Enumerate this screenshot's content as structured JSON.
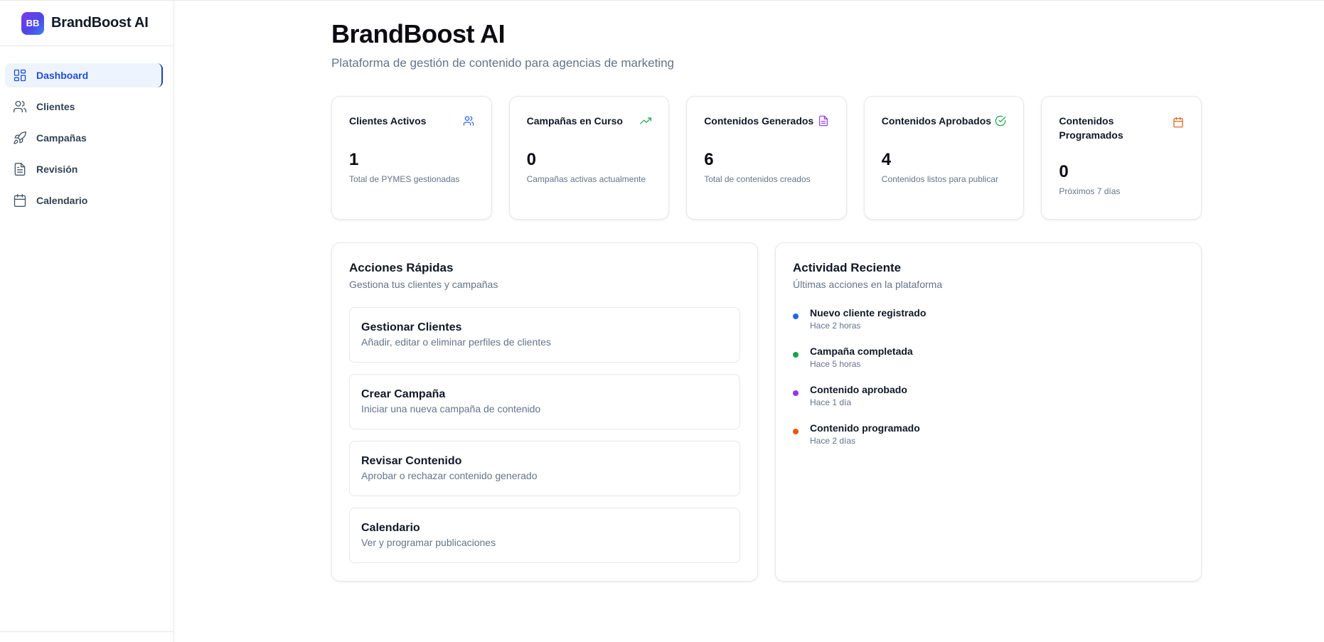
{
  "app": {
    "logo_text": "BB",
    "name": "BrandBoost AI"
  },
  "sidebar": {
    "items": [
      {
        "label": "Dashboard",
        "icon": "layout-dashboard-icon",
        "active": true
      },
      {
        "label": "Clientes",
        "icon": "users-icon"
      },
      {
        "label": "Campañas",
        "icon": "rocket-icon"
      },
      {
        "label": "Revisión",
        "icon": "file-text-icon"
      },
      {
        "label": "Calendario",
        "icon": "calendar-icon"
      }
    ]
  },
  "header": {
    "title": "BrandBoost AI",
    "subtitle": "Plataforma de gestión de contenido para agencias de marketing"
  },
  "stats": [
    {
      "title": "Clientes Activos",
      "value": "1",
      "desc": "Total de PYMES gestionadas",
      "icon": "users-icon",
      "color": "#2563eb"
    },
    {
      "title": "Campañas en Curso",
      "value": "0",
      "desc": "Campañas activas actualmente",
      "icon": "trending-up-icon",
      "color": "#16a34a"
    },
    {
      "title": "Contenidos Generados",
      "value": "6",
      "desc": "Total de contenidos creados",
      "icon": "file-text-icon",
      "color": "#9333ea"
    },
    {
      "title": "Contenidos Aprobados",
      "value": "4",
      "desc": "Contenidos listos para publicar",
      "icon": "check-circle-icon",
      "color": "#16a34a"
    },
    {
      "title": "Contenidos Programados",
      "value": "0",
      "desc": "Próximos 7 días",
      "icon": "calendar-icon",
      "color": "#ea580c"
    }
  ],
  "quick_actions": {
    "title": "Acciones Rápidas",
    "subtitle": "Gestiona tus clientes y campañas",
    "items": [
      {
        "title": "Gestionar Clientes",
        "desc": "Añadir, editar o eliminar perfiles de clientes"
      },
      {
        "title": "Crear Campaña",
        "desc": "Iniciar una nueva campaña de contenido"
      },
      {
        "title": "Revisar Contenido",
        "desc": "Aprobar o rechazar contenido generado"
      },
      {
        "title": "Calendario",
        "desc": "Ver y programar publicaciones"
      }
    ]
  },
  "recent_activity": {
    "title": "Actividad Reciente",
    "subtitle": "Últimas acciones en la plataforma",
    "items": [
      {
        "title": "Nuevo cliente registrado",
        "time": "Hace 2 horas",
        "color": "#2563eb"
      },
      {
        "title": "Campaña completada",
        "time": "Hace 5 horas",
        "color": "#16a34a"
      },
      {
        "title": "Contenido aprobado",
        "time": "Hace 1 día",
        "color": "#9333ea"
      },
      {
        "title": "Contenido programado",
        "time": "Hace 2 días",
        "color": "#ea580c"
      }
    ]
  }
}
